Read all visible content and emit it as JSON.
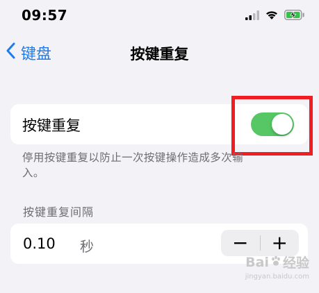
{
  "status_bar": {
    "time": "09:57",
    "signal_icon": "cellular-signal-icon",
    "wifi_icon": "wifi-icon",
    "battery_icon": "battery-charging-icon"
  },
  "nav": {
    "back_label": "键盘",
    "title": "按键重复"
  },
  "toggle_row": {
    "label": "按键重复",
    "state": "on",
    "on_color": "#56c764"
  },
  "footer_note": "停用按键重复以防止一次按键操作造成多次输入。",
  "interval_section": {
    "header": "按键重复间隔",
    "value": "0.10",
    "unit": "秒",
    "decrement_label": "−",
    "increment_label": "+"
  },
  "highlight": {
    "color": "#f01e23"
  },
  "watermark": {
    "logo_text_left": "Bai",
    "logo_text_right": "经验",
    "sub_text": "jingyan.baidu.com"
  },
  "colors": {
    "accent": "#1f7bea",
    "background": "#f2f2f7",
    "secondary_text": "#6d6d72"
  }
}
